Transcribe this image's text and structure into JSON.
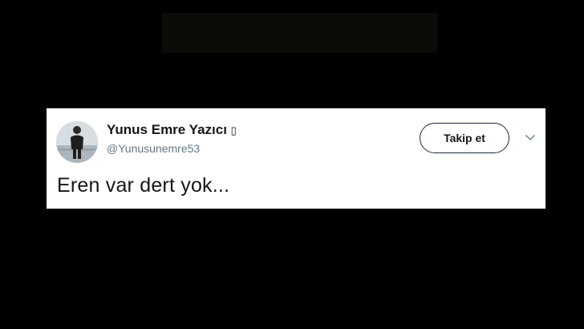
{
  "tweet": {
    "author_name": "Yunus Emre Yazıcı",
    "name_suffix": "▯",
    "handle": "@Yunusunemre53",
    "follow_label": "Takip et",
    "text": "Eren var dert yok..."
  },
  "icons": {
    "avatar": "profile-photo",
    "menu": "chevron-down-icon"
  },
  "colors": {
    "page_background": "#000000",
    "card_background": "#ffffff",
    "handle": "#657786",
    "caret": "#8899a6"
  }
}
